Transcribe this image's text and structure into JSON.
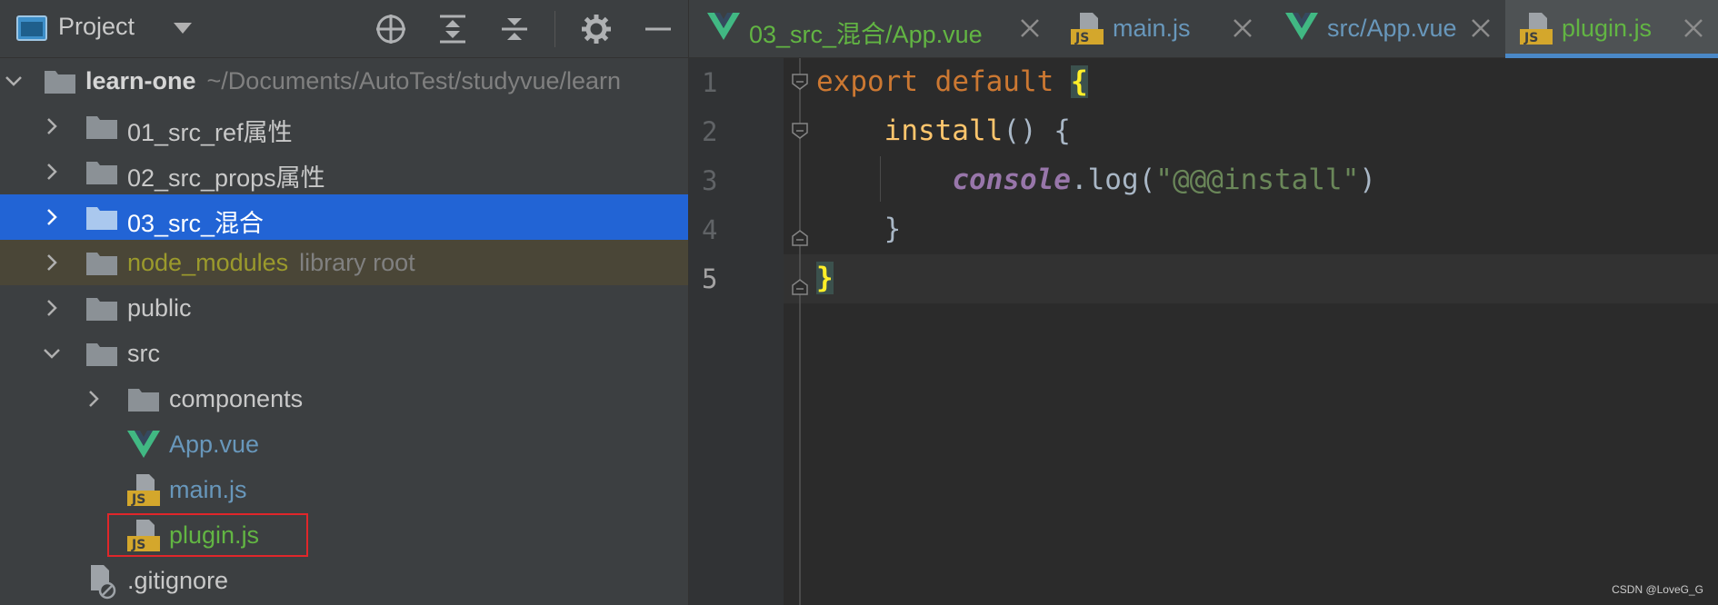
{
  "project_panel": {
    "title": "Project",
    "toolbar_icons": [
      "locate-icon",
      "expand-all-icon",
      "collapse-all-icon",
      "gear-icon",
      "hide-icon"
    ]
  },
  "tree": [
    {
      "label": "learn-one",
      "sub": "~/Documents/AutoTest/studyvue/learn",
      "type": "root-folder",
      "expanded": true
    },
    {
      "label": "01_src_ref属性",
      "type": "folder"
    },
    {
      "label": "02_src_props属性",
      "type": "folder"
    },
    {
      "label": "03_src_混合",
      "type": "folder",
      "selected": true
    },
    {
      "label": "node_modules",
      "sub": "library root",
      "type": "folder",
      "library": true
    },
    {
      "label": "public",
      "type": "folder"
    },
    {
      "label": "src",
      "type": "folder",
      "expanded": true
    },
    {
      "label": "components",
      "type": "folder"
    },
    {
      "label": "App.vue",
      "type": "vue"
    },
    {
      "label": "main.js",
      "type": "js"
    },
    {
      "label": "plugin.js",
      "type": "js",
      "highlighted": true
    },
    {
      "label": ".gitignore",
      "type": "ignore"
    }
  ],
  "tabs": [
    {
      "label": "03_src_混合/App.vue",
      "type": "vue",
      "color": "#62b543"
    },
    {
      "label": "main.js",
      "type": "js",
      "color": "#6897bb"
    },
    {
      "label": "src/App.vue",
      "type": "vue",
      "color": "#6897bb"
    },
    {
      "label": "plugin.js",
      "type": "js",
      "color": "#62b543",
      "active": true
    }
  ],
  "code": {
    "line_numbers": [
      "1",
      "2",
      "3",
      "4",
      "5"
    ],
    "lines": [
      {
        "tokens": [
          {
            "t": "export",
            "c": "kw"
          },
          {
            "t": " ",
            "c": "plain"
          },
          {
            "t": "default",
            "c": "kw"
          },
          {
            "t": " ",
            "c": "plain"
          },
          {
            "t": "{",
            "c": "brace-hl"
          }
        ]
      },
      {
        "tokens": [
          {
            "t": "    ",
            "c": "plain"
          },
          {
            "t": "install",
            "c": "fn"
          },
          {
            "t": "() {",
            "c": "plain"
          }
        ]
      },
      {
        "tokens": [
          {
            "t": "        ",
            "c": "plain"
          },
          {
            "t": "console",
            "c": "italic-obj"
          },
          {
            "t": ".log(",
            "c": "plain"
          },
          {
            "t": "\"@@@install\"",
            "c": "str"
          },
          {
            "t": ")",
            "c": "plain"
          }
        ]
      },
      {
        "tokens": [
          {
            "t": "    }",
            "c": "plain"
          }
        ]
      },
      {
        "tokens": [
          {
            "t": "}",
            "c": "brace-hl"
          }
        ]
      }
    ]
  },
  "watermark": "CSDN @LoveG_G",
  "colors": {
    "selected": "#2264d5",
    "library": "#4a4637",
    "vue_green": "#41b883",
    "js_badge": "#d4a72c",
    "highlight_border": "#e0262a"
  }
}
